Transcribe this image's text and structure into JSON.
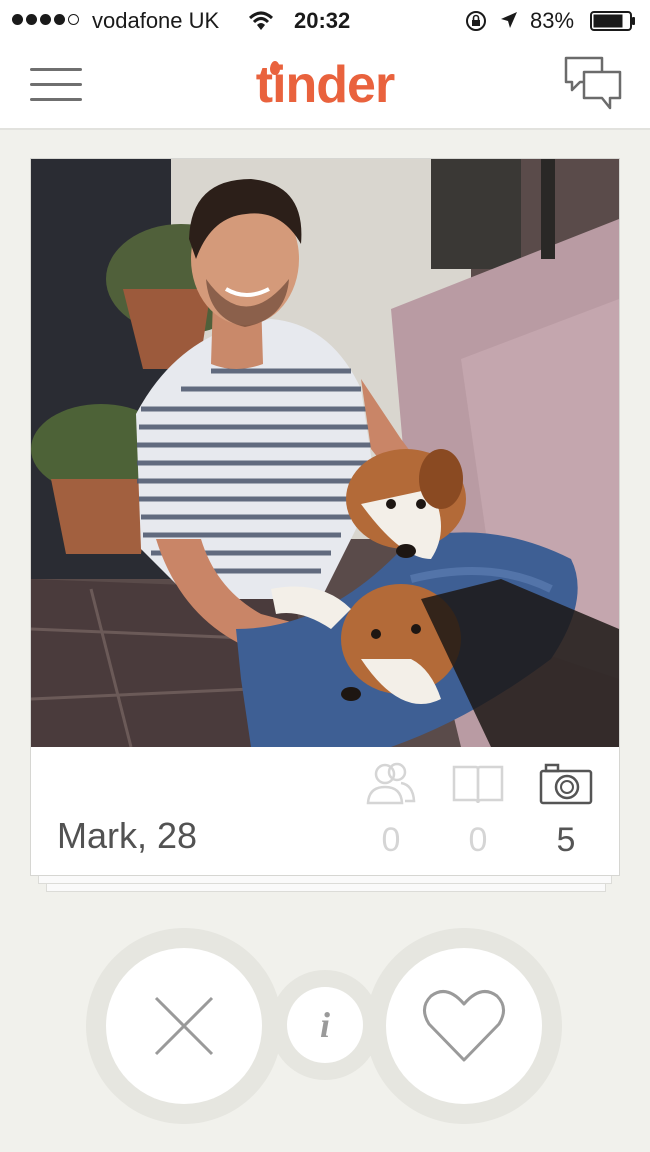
{
  "status_bar": {
    "carrier": "vodafone UK",
    "time": "20:32",
    "battery": "83%",
    "battery_level": 0.83,
    "signal_bars_filled": 4,
    "signal_bars_total": 5
  },
  "nav": {
    "logo": "tinder",
    "menu_icon": "hamburger-menu-icon",
    "chat_icon": "chat-bubbles-icon"
  },
  "profile": {
    "name_age": "Mark, 28",
    "stats": {
      "common_friends": "0",
      "common_interests": "0",
      "photos": "5"
    }
  },
  "actions": {
    "dislike_icon": "x-icon",
    "info_icon": "info-icon",
    "info_letter": "i",
    "like_icon": "heart-icon"
  },
  "colors": {
    "brand": "#e9623d",
    "background": "#f1f1ec",
    "muted_icon": "#d5d5d5",
    "text": "#525252"
  }
}
